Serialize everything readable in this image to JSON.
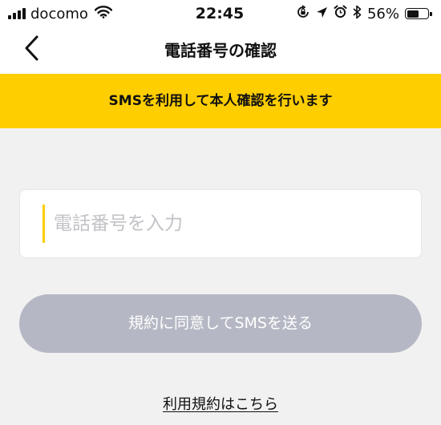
{
  "status_bar": {
    "carrier": "docomo",
    "time": "22:45",
    "battery_percent": "56%",
    "battery_level": 0.56,
    "icons": [
      "signal-bars-icon",
      "wifi-icon",
      "orientation-lock-icon",
      "location-arrow-icon",
      "alarm-clock-icon",
      "bluetooth-icon",
      "battery-icon"
    ]
  },
  "nav": {
    "title": "電話番号の確認",
    "back_icon": "chevron-left-icon"
  },
  "banner": {
    "text": "SMSを利用して本人確認を行います",
    "color": "#fece00"
  },
  "phone_input": {
    "value": "",
    "placeholder": "電話番号を入力"
  },
  "sms_button": {
    "label": "規約に同意してSMSを送る",
    "color": "#b5b8c4"
  },
  "terms_link": {
    "label": "利用規約はこちら"
  }
}
